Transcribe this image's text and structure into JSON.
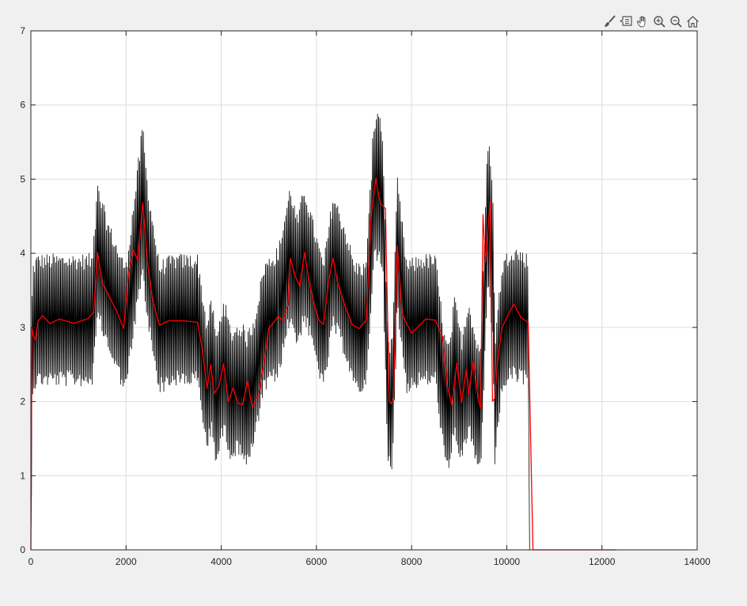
{
  "toolbar": {
    "buttons": [
      {
        "name": "brush-icon",
        "title": "Brush"
      },
      {
        "name": "datatip-icon",
        "title": "Data Tips"
      },
      {
        "name": "pan-hand-icon",
        "title": "Pan"
      },
      {
        "name": "zoom-in-icon",
        "title": "Zoom In"
      },
      {
        "name": "zoom-out-icon",
        "title": "Zoom Out"
      },
      {
        "name": "home-icon",
        "title": "Restore View"
      }
    ]
  },
  "colors": {
    "background": "#f0f0f0",
    "axes_bg": "#ffffff",
    "grid": "#dedede",
    "axis": "#262626",
    "series_raw": "#000000",
    "series_filtered": "#ff0000"
  },
  "chart_data": {
    "type": "line",
    "title": "",
    "xlabel": "",
    "ylabel": "",
    "xlim": [
      0,
      14000
    ],
    "ylim": [
      0,
      7
    ],
    "grid": true,
    "legend": "none",
    "x_ticks": [
      0,
      2000,
      4000,
      6000,
      8000,
      10000,
      12000,
      14000
    ],
    "y_ticks": [
      0,
      1,
      2,
      3,
      4,
      5,
      6,
      7
    ],
    "series": [
      {
        "color": "#000000",
        "style": "oscillating signal",
        "segments": [
          {
            "x": [
              0,
              20,
              30,
              60,
              120,
              1300
            ],
            "center": [
              0,
              2.0,
              3.0,
              3.0,
              3.1,
              3.1
            ],
            "amp": [
              0.2,
              0.9,
              0.9,
              0.9,
              0.9,
              0.9
            ]
          },
          {
            "x": [
              1300,
              1400,
              1600,
              1900,
              2000
            ],
            "center": [
              3.1,
              4.0,
              3.6,
              3.1,
              3.0
            ],
            "amp": [
              0.9,
              0.95,
              0.9,
              0.9,
              0.9
            ]
          },
          {
            "x": [
              2000,
              2200,
              2350,
              2450,
              2700,
              3000,
              3500
            ],
            "center": [
              3.0,
              4.0,
              4.7,
              4.0,
              3.0,
              3.1,
              3.1
            ],
            "amp": [
              0.9,
              0.95,
              1.1,
              1.0,
              0.9,
              0.9,
              0.9
            ]
          },
          {
            "x": [
              3500,
              3700,
              3800,
              3900,
              4050,
              4200,
              4400,
              4550,
              4700,
              4900,
              5200
            ],
            "center": [
              3.1,
              2.2,
              2.5,
              2.0,
              2.5,
              2.1,
              2.2,
              2.0,
              2.3,
              3.0,
              3.2
            ],
            "amp": [
              0.9,
              0.9,
              0.95,
              0.9,
              0.95,
              0.9,
              0.9,
              0.95,
              0.9,
              0.9,
              0.9
            ]
          },
          {
            "x": [
              5200,
              5450,
              5600,
              5750,
              5950,
              6150,
              6350,
              6600,
              6800,
              7050
            ],
            "center": [
              3.2,
              4.0,
              3.6,
              4.0,
              3.5,
              3.0,
              3.9,
              3.5,
              3.0,
              3.0
            ],
            "amp": [
              0.9,
              0.95,
              0.9,
              0.95,
              0.9,
              0.9,
              0.95,
              0.9,
              0.9,
              0.9
            ]
          },
          {
            "x": [
              7050,
              7200,
              7300,
              7400,
              7500,
              7550,
              7600
            ],
            "center": [
              3.0,
              4.8,
              5.0,
              4.6,
              2.0,
              1.9,
              2.0
            ],
            "amp": [
              0.9,
              1.0,
              1.1,
              1.0,
              0.9,
              0.9,
              0.9
            ]
          },
          {
            "x": [
              7600,
              7700,
              7900,
              8200,
              8500,
              8700,
              8800,
              8900,
              9050,
              9200,
              9350,
              9450
            ],
            "center": [
              2.0,
              4.1,
              3.0,
              3.1,
              3.1,
              2.0,
              1.9,
              2.5,
              2.0,
              2.5,
              2.0,
              1.9
            ],
            "amp": [
              0.9,
              0.95,
              0.9,
              0.9,
              0.9,
              0.9,
              0.9,
              0.95,
              0.9,
              0.95,
              0.9,
              0.9
            ]
          },
          {
            "x": [
              9450,
              9600,
              9700,
              9750,
              9900,
              10100,
              10450
            ],
            "center": [
              1.9,
              4.5,
              4.0,
              2.0,
              3.0,
              3.2,
              3.1
            ],
            "amp": [
              0.9,
              1.1,
              1.2,
              0.9,
              0.9,
              0.95,
              0.9
            ]
          }
        ],
        "tail": {
          "x": [
            10480,
            10500,
            12300
          ],
          "y": [
            0,
            0,
            0
          ]
        }
      },
      {
        "color": "#ff0000",
        "style": "smoothed signal",
        "x": [
          0,
          20,
          50,
          100,
          150,
          250,
          400,
          600,
          900,
          1200,
          1320,
          1400,
          1500,
          1650,
          1800,
          1950,
          2050,
          2150,
          2250,
          2350,
          2450,
          2550,
          2700,
          2900,
          3200,
          3500,
          3600,
          3700,
          3780,
          3850,
          3950,
          4050,
          4150,
          4250,
          4350,
          4450,
          4550,
          4650,
          4800,
          5000,
          5200,
          5300,
          5400,
          5450,
          5550,
          5650,
          5750,
          5850,
          5950,
          6050,
          6150,
          6250,
          6350,
          6450,
          6600,
          6750,
          6900,
          7050,
          7150,
          7250,
          7300,
          7350,
          7450,
          7500,
          7530,
          7570,
          7620,
          7700,
          7800,
          8000,
          8300,
          8500,
          8650,
          8750,
          8850,
          8950,
          9050,
          9150,
          9200,
          9300,
          9400,
          9450,
          9500,
          9550,
          9650,
          9700,
          9750,
          9800,
          9900,
          10050,
          10150,
          10300,
          10450,
          10550,
          10600,
          12300
        ],
        "y": [
          0,
          3.0,
          2.9,
          2.85,
          3.1,
          3.15,
          3.05,
          3.1,
          3.05,
          3.1,
          3.2,
          4.0,
          3.6,
          3.4,
          3.2,
          3.0,
          3.7,
          4.05,
          3.9,
          4.7,
          3.9,
          3.4,
          3.05,
          3.1,
          3.1,
          3.05,
          2.7,
          2.2,
          2.5,
          2.1,
          2.2,
          2.5,
          2.0,
          2.2,
          2.0,
          1.95,
          2.3,
          1.9,
          2.1,
          3.0,
          3.15,
          3.1,
          3.3,
          3.95,
          3.7,
          3.55,
          4.0,
          3.6,
          3.3,
          3.1,
          3.05,
          3.6,
          3.95,
          3.6,
          3.3,
          3.05,
          3.0,
          3.1,
          4.5,
          5.0,
          4.8,
          4.65,
          4.6,
          3.0,
          2.0,
          1.95,
          2.05,
          4.1,
          3.2,
          2.9,
          3.1,
          3.1,
          2.9,
          2.2,
          1.95,
          2.5,
          2.0,
          2.45,
          2.1,
          2.55,
          2.05,
          1.9,
          4.5,
          3.9,
          4.7,
          2.0,
          2.05,
          2.5,
          3.0,
          3.2,
          3.3,
          3.15,
          3.05,
          0,
          0,
          0
        ]
      }
    ]
  }
}
